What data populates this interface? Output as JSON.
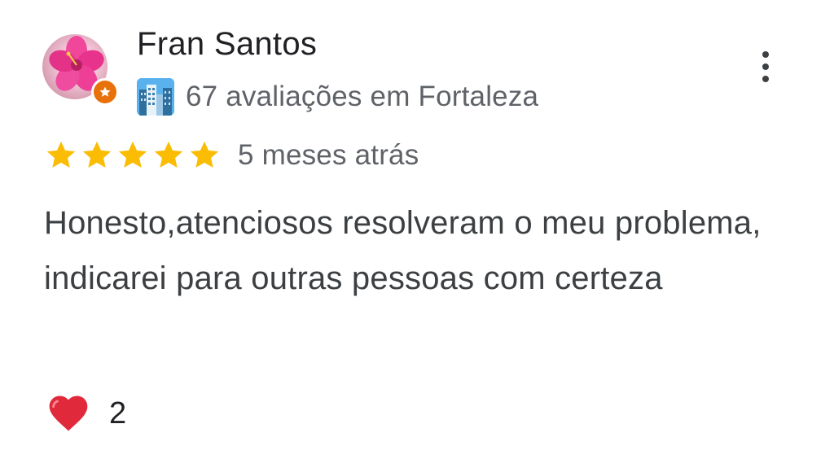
{
  "reviewer": {
    "name": "Fran Santos",
    "badge_icon": "local-guide-star-icon",
    "meta_icon": "cityscape-icon",
    "meta_text": "67 avaliações em Fortaleza"
  },
  "review": {
    "rating": 5,
    "rating_max": 5,
    "time_ago": "5 meses atrás",
    "text": "Honesto,atenciosos resolveram o meu problema, indicarei para outras pessoas com certeza"
  },
  "reactions": {
    "icon": "heart-icon",
    "count": "2"
  },
  "colors": {
    "star": "#fbbc04",
    "badge": "#e8710a",
    "heart": "#e02a3c",
    "name": "#202124",
    "secondary": "#5f6368"
  }
}
